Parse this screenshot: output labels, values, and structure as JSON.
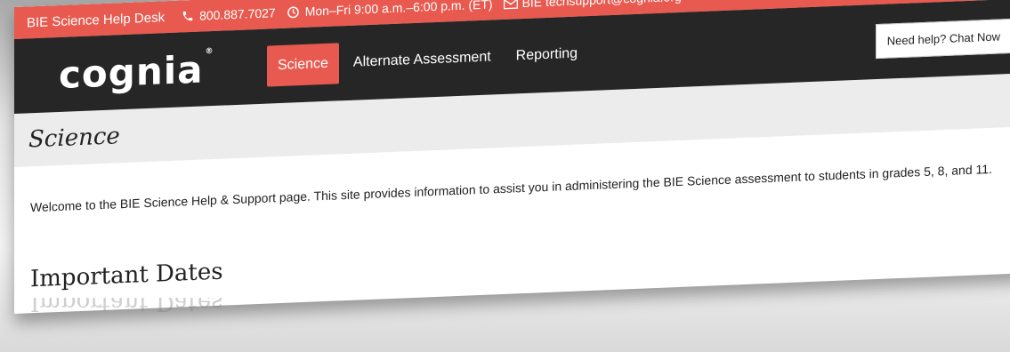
{
  "topbar": {
    "desk_label": "BIE Science Help Desk",
    "phone": "800.887.7027",
    "hours": "Mon–Fri 9:00 a.m.–6:00 p.m. (ET)",
    "email": "BIE techsupport@cognia.org",
    "phone_icon": "phone-icon",
    "clock_icon": "clock-icon",
    "mail_icon": "mail-icon"
  },
  "nav": {
    "logo": "cognia",
    "items": [
      {
        "label": "Science",
        "active": true
      },
      {
        "label": "Alternate Assessment",
        "active": false
      },
      {
        "label": "Reporting",
        "active": false
      }
    ],
    "chat_label": "Need help? Chat Now"
  },
  "page": {
    "title": "Science",
    "intro": "Welcome to the BIE Science Help & Support page. This site provides information to assist you in administering the BIE Science assessment to students in grades 5, 8, and 11.",
    "section_heading": "Important Dates"
  },
  "colors": {
    "accent": "#e85a4f",
    "nav_bg": "#262626",
    "title_bg": "#ececec"
  }
}
